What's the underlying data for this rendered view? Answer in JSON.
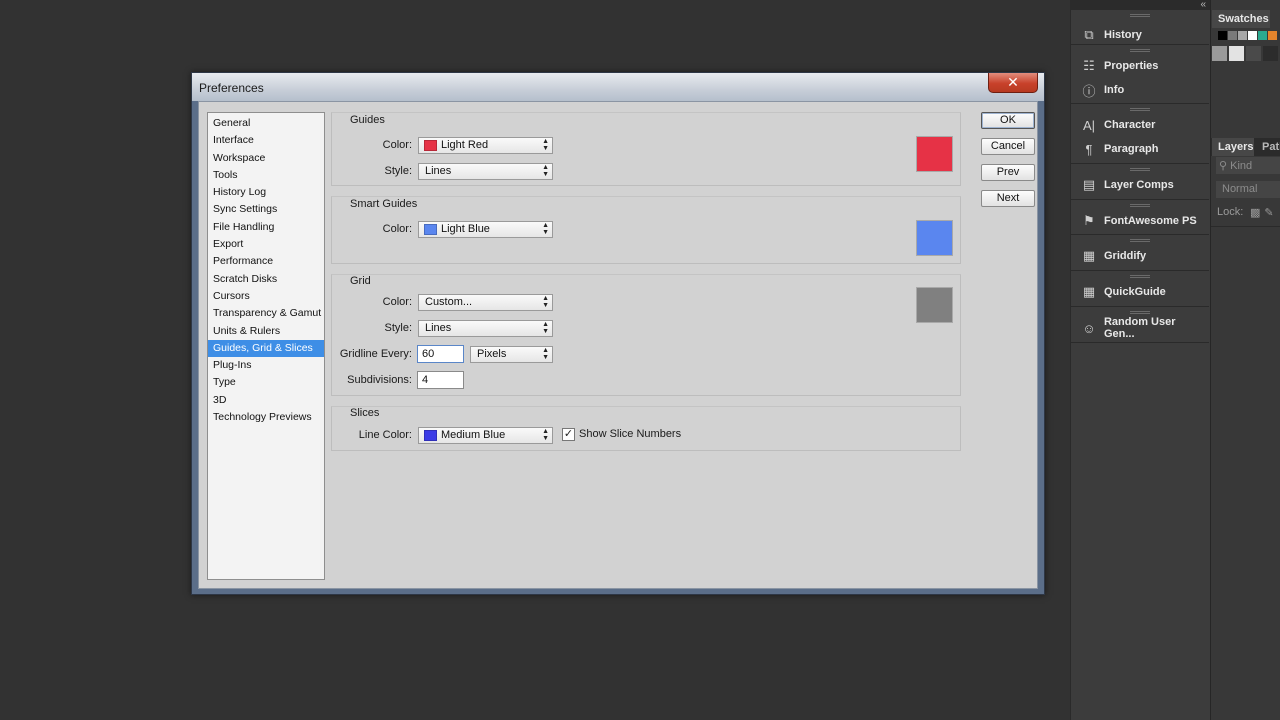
{
  "dialog": {
    "title": "Preferences",
    "close_glyph": "✕",
    "categories": [
      "General",
      "Interface",
      "Workspace",
      "Tools",
      "History Log",
      "Sync Settings",
      "File Handling",
      "Export",
      "Performance",
      "Scratch Disks",
      "Cursors",
      "Transparency & Gamut",
      "Units & Rulers",
      "Guides, Grid & Slices",
      "Plug-Ins",
      "Type",
      "3D",
      "Technology Previews"
    ],
    "selected_category": "Guides, Grid & Slices",
    "buttons": {
      "ok": "OK",
      "cancel": "Cancel",
      "prev": "Prev",
      "next": "Next"
    }
  },
  "guides": {
    "title": "Guides",
    "color_label": "Color:",
    "color_value": "Light Red",
    "color_hex": "#e63246",
    "style_label": "Style:",
    "style_value": "Lines"
  },
  "smart_guides": {
    "title": "Smart Guides",
    "color_label": "Color:",
    "color_value": "Light Blue",
    "color_hex": "#5a86ef"
  },
  "grid": {
    "title": "Grid",
    "color_label": "Color:",
    "color_value": "Custom...",
    "color_hex": "#808080",
    "style_label": "Style:",
    "style_value": "Lines",
    "gridline_label": "Gridline Every:",
    "gridline_value": "60",
    "gridline_unit": "Pixels",
    "subdivisions_label": "Subdivisions:",
    "subdivisions_value": "4"
  },
  "slices": {
    "title": "Slices",
    "line_color_label": "Line Color:",
    "line_color_value": "Medium Blue",
    "line_color_hex": "#3b3be6",
    "show_numbers_label": "Show Slice Numbers",
    "show_numbers_checked": true
  },
  "dock": {
    "collapse_glyph": "«",
    "items": [
      {
        "label": "History",
        "icon": "history-icon",
        "glyph": "⧉"
      },
      {
        "label": "Properties",
        "icon": "properties-icon",
        "glyph": "☷"
      },
      {
        "label": "Info",
        "icon": "info-icon",
        "glyph": "ⓘ"
      },
      {
        "label": "Character",
        "icon": "character-icon",
        "glyph": "A|"
      },
      {
        "label": "Paragraph",
        "icon": "paragraph-icon",
        "glyph": "¶"
      },
      {
        "label": "Layer Comps",
        "icon": "layer-comps-icon",
        "glyph": "▤"
      },
      {
        "label": "FontAwesome PS",
        "icon": "flag-icon",
        "glyph": "⚑"
      },
      {
        "label": "Griddify",
        "icon": "extension-icon",
        "glyph": "▦"
      },
      {
        "label": "QuickGuide",
        "icon": "extension-icon",
        "glyph": "▦"
      },
      {
        "label": "Random User Gen...",
        "icon": "user-icon",
        "glyph": "☺"
      }
    ],
    "swatches_tab": "Swatches",
    "swatch_colors": [
      "#000000",
      "#7a7a7a",
      "#a8a8a8",
      "#ffffff",
      "#2aa98f",
      "#e4842c"
    ],
    "swatch_big_colors": [
      "#9a9a9a",
      "#e3e3e3",
      "#4a4a4a",
      "#4a4a4a",
      "#2c2c2c"
    ],
    "layers_tab": "Layers",
    "paths_tab": "Path",
    "kind_placeholder": "Kind",
    "search_glyph": "⚲",
    "blend_mode": "Normal",
    "lock_label": "Lock:",
    "lock_glyphs": "▩✎"
  }
}
